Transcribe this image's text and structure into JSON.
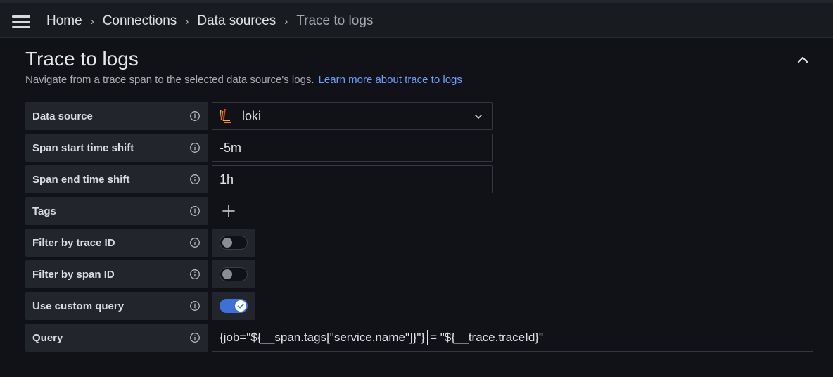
{
  "breadcrumb": {
    "items": [
      "Home",
      "Connections",
      "Data sources"
    ],
    "current": "Trace to logs"
  },
  "section": {
    "title": "Trace to logs",
    "description": "Navigate from a trace span to the selected data source's logs.",
    "link": "Learn more about trace to logs"
  },
  "form": {
    "data_source": {
      "label": "Data source",
      "value": "loki",
      "icon": "loki-logo-icon"
    },
    "span_start": {
      "label": "Span start time shift",
      "value": "-5m"
    },
    "span_end": {
      "label": "Span end time shift",
      "value": "1h"
    },
    "tags": {
      "label": "Tags"
    },
    "filter_trace": {
      "label": "Filter by trace ID",
      "on": false
    },
    "filter_span": {
      "label": "Filter by span ID",
      "on": false
    },
    "custom_query": {
      "label": "Use custom query",
      "on": true
    },
    "query": {
      "label": "Query",
      "value_before_cursor": "{job=\"${__span.tags[\"service.name\"]}\"}",
      "value_after_cursor": "= \"${__trace.traceId}\""
    }
  },
  "colors": {
    "accent": "#3d71d9",
    "link": "#6e9fff",
    "background": "#111217",
    "label_bg": "#22252b"
  }
}
